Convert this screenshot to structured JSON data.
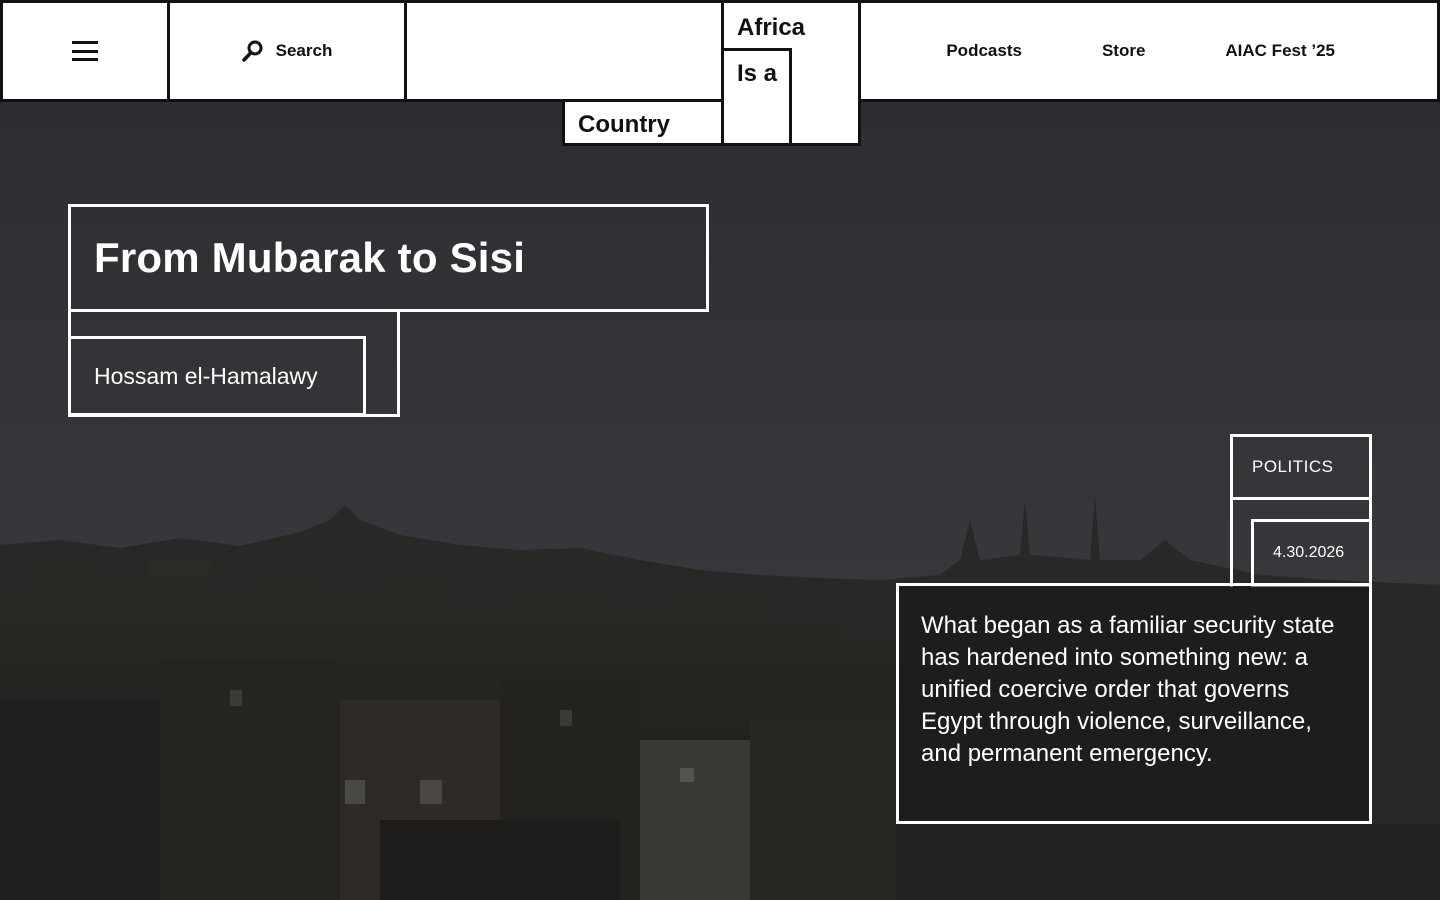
{
  "header": {
    "menu_icon": "hamburger-menu-icon",
    "search_icon": "search-icon",
    "search_label": "Search",
    "nav": [
      "Podcasts",
      "Store",
      "AIAC Fest ’25"
    ]
  },
  "logo": {
    "line1": "Africa",
    "line2": "Is a",
    "line3": "Country"
  },
  "article": {
    "title": "From Mubarak to Sisi",
    "author": "Hossam el-Hamalawy",
    "category": "POLITICS",
    "date": "4.30.2026",
    "excerpt": "What began as a familiar security state has hardened into something new: a unified coercive order that governs Egypt through violence, surveillance, and permanent emergency."
  },
  "colors": {
    "header_bg": "#ffffff",
    "border": "#111111",
    "hero_text": "#ffffff"
  }
}
